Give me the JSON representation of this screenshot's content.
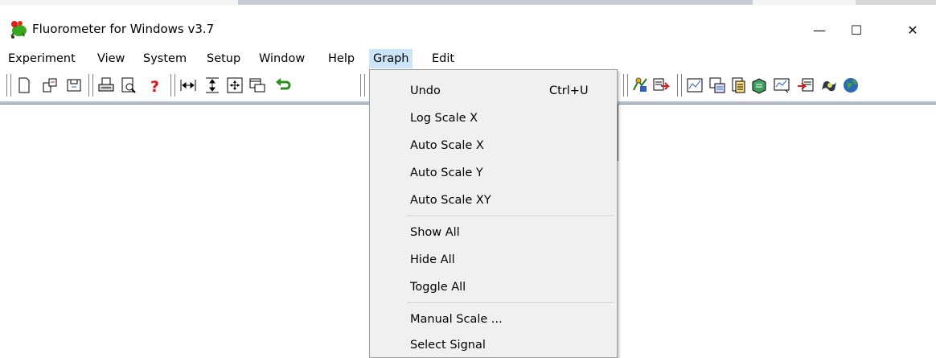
{
  "window": {
    "title": "Fluorometer for Windows v3.7",
    "minimize_glyph": "—",
    "maximize_glyph": "☐",
    "close_glyph": "✕"
  },
  "menubar": {
    "items": [
      "Experiment",
      "View",
      "System",
      "Setup",
      "Window",
      "Help",
      "Graph",
      "Edit"
    ],
    "active": "Graph"
  },
  "graph_menu": {
    "items": [
      {
        "label": "Undo",
        "shortcut": "Ctrl+U"
      },
      {
        "label": "Log Scale X"
      },
      {
        "label": "Auto Scale X"
      },
      {
        "label": "Auto Scale Y"
      },
      {
        "label": "Auto Scale XY"
      },
      {
        "label": "Show All"
      },
      {
        "label": "Hide All"
      },
      {
        "label": "Toggle All"
      },
      {
        "label": "Manual Scale ..."
      },
      {
        "label": "Select Signal"
      }
    ]
  },
  "toolbar": {
    "icons": [
      "new-file-icon",
      "open-file-icon",
      "save-file-icon",
      "print-icon",
      "print-preview-icon",
      "help-icon",
      "expand-horizontal-icon",
      "expand-vertical-icon",
      "expand-all-icon",
      "window-icon",
      "undo-arrow-icon",
      "instrument-icon",
      "export-icon",
      "graph-icon",
      "data-icon",
      "document-icon",
      "notes-icon",
      "chart-icon",
      "import-icon",
      "signal-icon",
      "globe-icon"
    ]
  },
  "colors": {
    "menu_highlight": "#cce4f7",
    "menu_background": "#f0f0f0",
    "help_icon": "#e81010",
    "undo_arrow": "#2a8f1c"
  }
}
